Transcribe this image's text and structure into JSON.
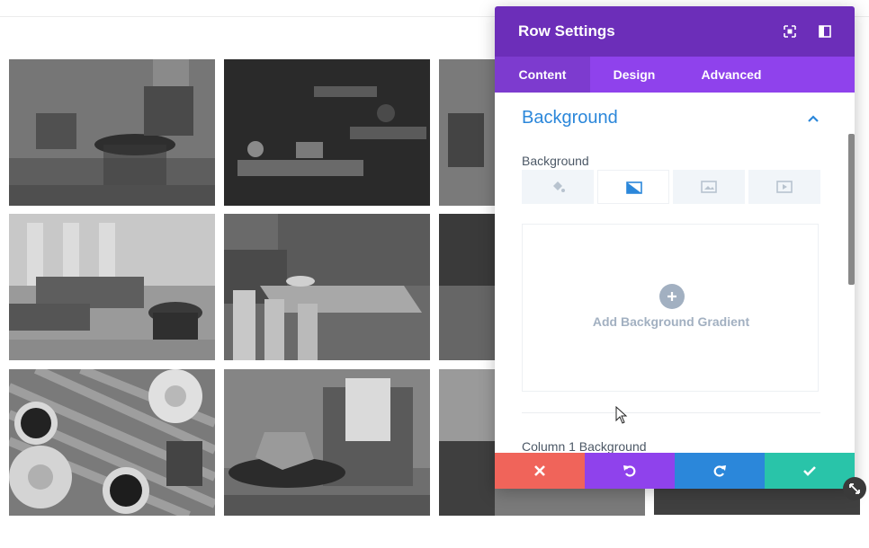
{
  "panel": {
    "title": "Row Settings",
    "tabs": [
      {
        "label": "Content",
        "active": true
      },
      {
        "label": "Design",
        "active": false
      },
      {
        "label": "Advanced",
        "active": false
      }
    ]
  },
  "section": {
    "title": "Background"
  },
  "background_field": {
    "label": "Background",
    "types": [
      "color",
      "gradient",
      "image",
      "video"
    ],
    "active_type": "gradient",
    "add_gradient_label": "Add Background Gradient"
  },
  "column_background_label": "Column 1 Background",
  "footer": {
    "buttons": [
      "discard",
      "undo",
      "redo",
      "save"
    ]
  },
  "colors": {
    "header": "#6c2eb9",
    "tabs": "#8f42ec",
    "active_tab": "#7d3bcf",
    "accent_blue": "#2b87da",
    "discard": "#f0645a",
    "undo": "#8f42ec",
    "redo": "#2b87da",
    "save": "#29c4a9"
  },
  "icons": [
    "snap-to-position-icon",
    "split-view-icon",
    "chevron-up-icon",
    "paint-bucket-icon",
    "gradient-icon",
    "image-icon",
    "video-icon",
    "plus-icon",
    "close-icon",
    "undo-icon",
    "redo-icon",
    "check-icon",
    "resize-icon"
  ]
}
